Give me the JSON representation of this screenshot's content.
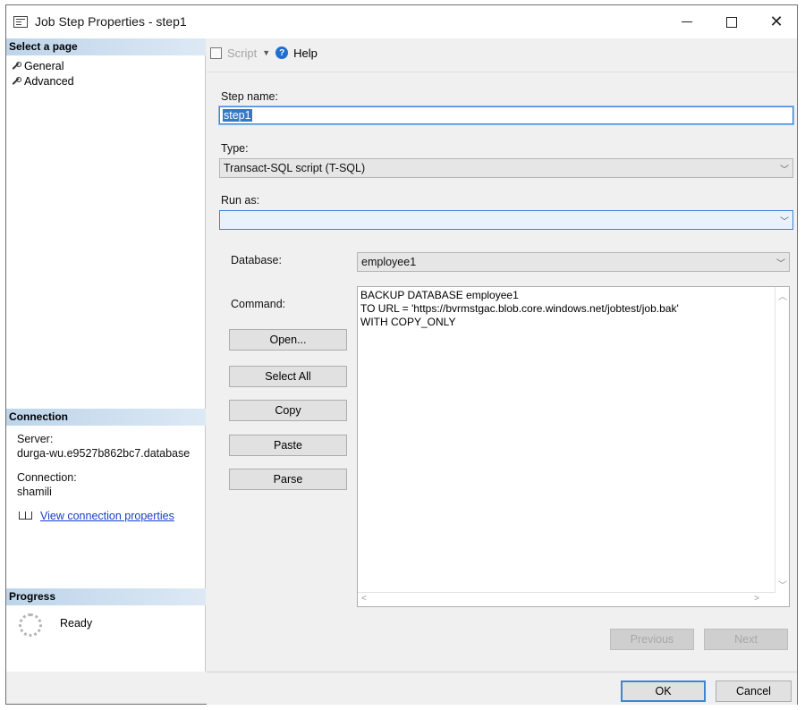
{
  "window": {
    "title": "Job Step Properties - step1"
  },
  "left": {
    "select_page_header": "Select a page",
    "pages": [
      {
        "label": "General"
      },
      {
        "label": "Advanced"
      }
    ],
    "connection_header": "Connection",
    "server_label": "Server:",
    "server_value": "durga-wu.e9527b862bc7.database",
    "connection_label": "Connection:",
    "connection_value": "shamili",
    "view_link": "View connection properties",
    "progress_header": "Progress",
    "progress_status": "Ready"
  },
  "toolbar": {
    "script_label": "Script",
    "help_label": "Help"
  },
  "form": {
    "step_name_label": "Step name:",
    "step_name_value": "step1",
    "type_label": "Type:",
    "type_value": "Transact-SQL script (T-SQL)",
    "run_as_label": "Run as:",
    "run_as_value": "",
    "database_label": "Database:",
    "database_value": "employee1",
    "command_label": "Command:",
    "command_lines": [
      "BACKUP DATABASE employee1",
      "TO URL = 'https://bvrmstgac.blob.core.windows.net/jobtest/job.bak'",
      "WITH COPY_ONLY"
    ]
  },
  "command_buttons": {
    "open": "Open...",
    "select_all": "Select All",
    "copy": "Copy",
    "paste": "Paste",
    "parse": "Parse"
  },
  "nav_buttons": {
    "previous": "Previous",
    "next": "Next"
  },
  "dialog_buttons": {
    "ok": "OK",
    "cancel": "Cancel"
  }
}
